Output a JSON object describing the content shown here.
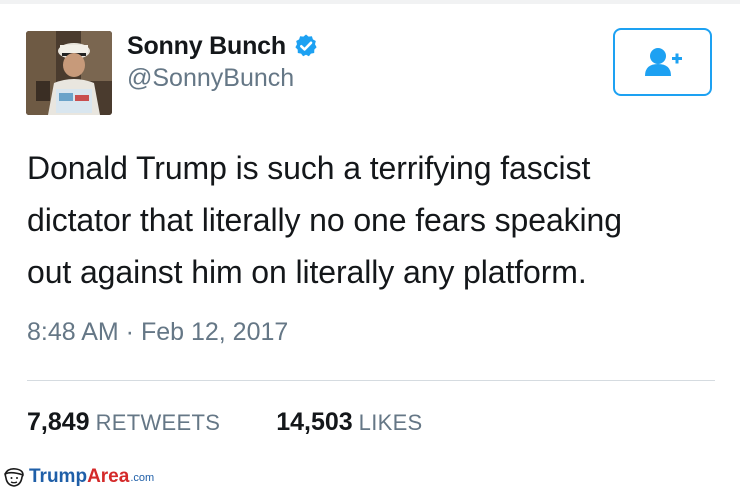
{
  "author": {
    "display_name": "Sonny Bunch",
    "handle": "@SonnyBunch",
    "verified": true,
    "avatar_icon": "profile-photo"
  },
  "follow_button": {
    "icon": "add-user-icon",
    "color": "#1da1f2"
  },
  "tweet": {
    "lines": [
      "Donald Trump is such a terrifying fascist",
      "dictator that literally no one fears speaking",
      "out against him on literally any platform."
    ],
    "timestamp": "8:48 AM · Feb 12, 2017"
  },
  "stats": {
    "retweets_count": "7,849",
    "retweets_label": "RETWEETS",
    "likes_count": "14,503",
    "likes_label": "LIKES"
  },
  "watermark": {
    "part1": "Trump",
    "part2": "Area",
    "part3": ".com"
  },
  "colors": {
    "accent": "#1da1f2",
    "text": "#14171a",
    "muted": "#657786",
    "divider": "#d5dbe0"
  }
}
